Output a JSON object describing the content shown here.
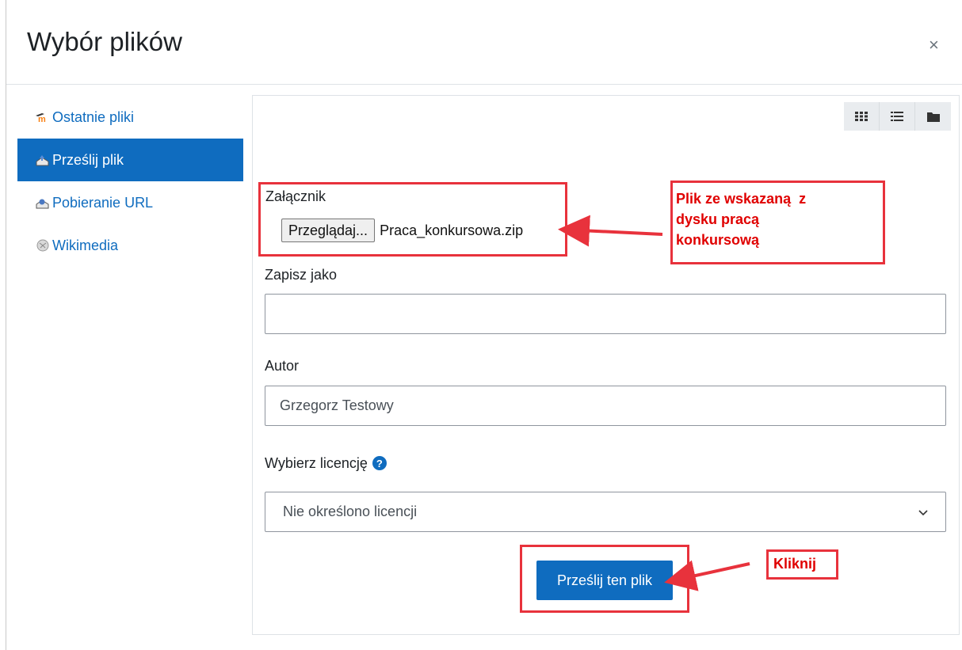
{
  "dialog": {
    "title": "Wybór plików",
    "close_symbol": "×"
  },
  "sidebar": {
    "items": [
      {
        "label": "Ostatnie pliki",
        "icon": "moodle-icon",
        "active": false
      },
      {
        "label": "Prześlij plik",
        "icon": "upload-icon",
        "active": true
      },
      {
        "label": "Pobieranie URL",
        "icon": "url-download-icon",
        "active": false
      },
      {
        "label": "Wikimedia",
        "icon": "wikimedia-icon",
        "active": false
      }
    ]
  },
  "view_toolbar": {
    "buttons": [
      "grid-view-icon",
      "list-view-icon",
      "folder-view-icon"
    ]
  },
  "form": {
    "attachment_label": "Załącznik",
    "browse_label": "Przeglądaj...",
    "selected_file": "Praca_konkursowa.zip",
    "save_as_label": "Zapisz jako",
    "save_as_value": "",
    "author_label": "Autor",
    "author_value": "Grzegorz Testowy",
    "license_label": "Wybierz licencję",
    "license_selected": "Nie określono licencji",
    "submit_label": "Prześlij ten plik"
  },
  "annotations": {
    "file_note_lines": [
      "Plik ze wskazaną  z",
      "dysku pracą",
      "konkursową"
    ],
    "click_note": "Kliknij"
  },
  "colors": {
    "accent": "#0f6cbf",
    "annotation_red": "#e8323c",
    "annotation_text": "#e00000"
  }
}
